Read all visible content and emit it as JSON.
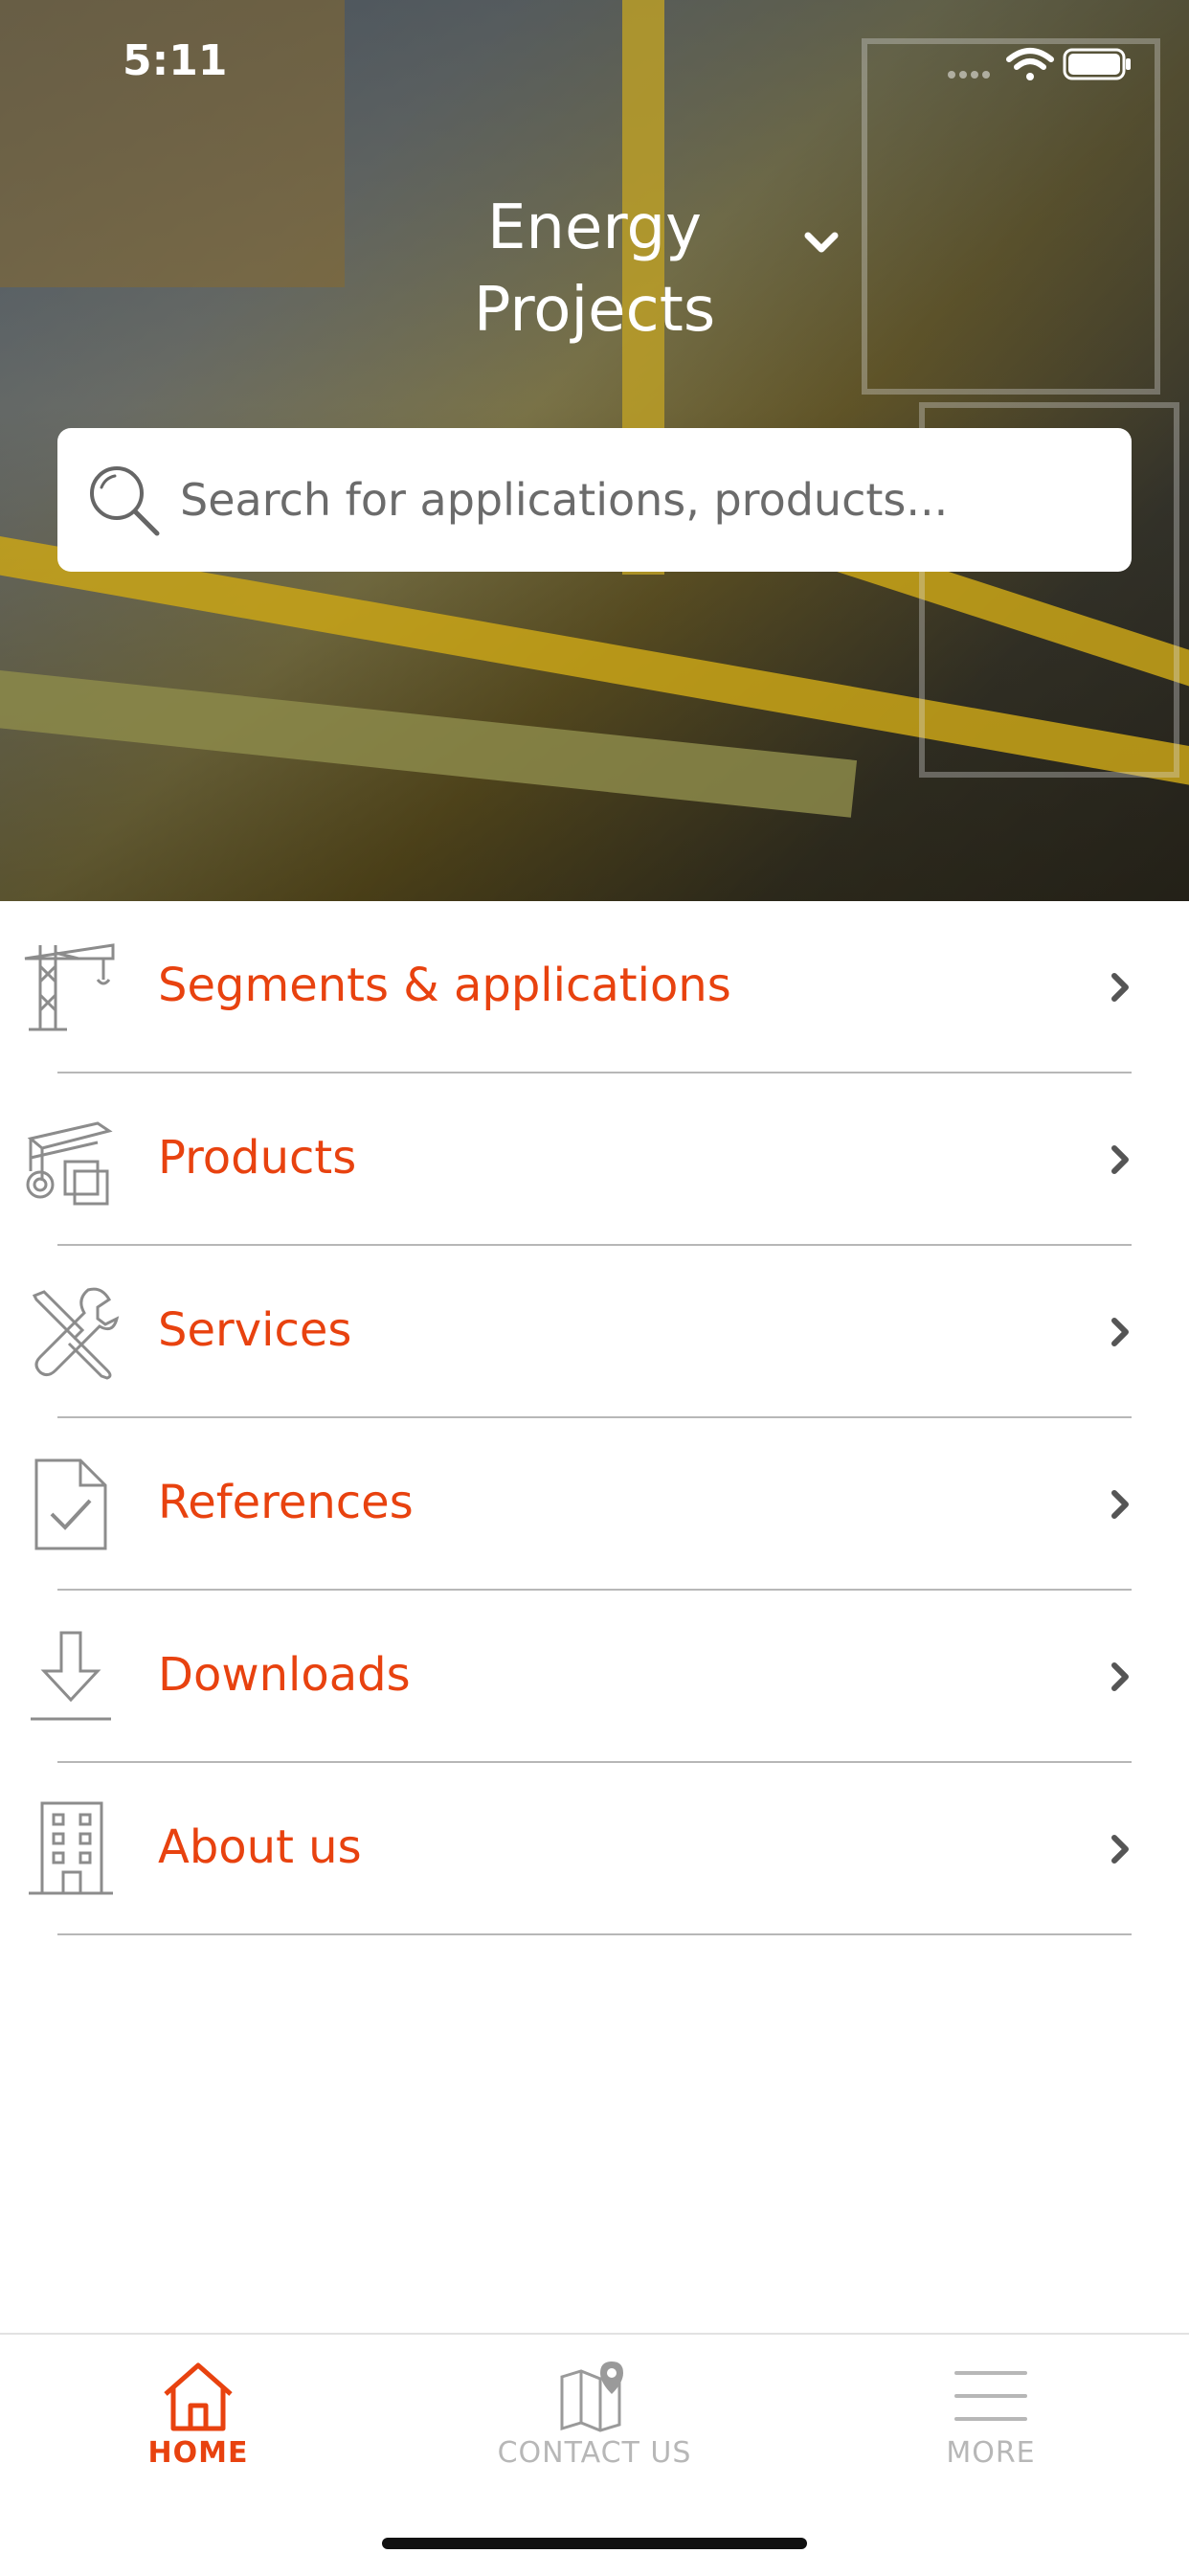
{
  "status_bar": {
    "time": "5:11"
  },
  "header": {
    "title": "Energy Projects"
  },
  "search": {
    "placeholder": "Search for applications, products..."
  },
  "menu": {
    "items": [
      {
        "label": "Segments & applications",
        "icon": "crane-icon"
      },
      {
        "label": "Products",
        "icon": "steel-profiles-icon"
      },
      {
        "label": "Services",
        "icon": "tools-icon"
      },
      {
        "label": "References",
        "icon": "document-check-icon"
      },
      {
        "label": "Downloads",
        "icon": "download-icon"
      },
      {
        "label": "About us",
        "icon": "building-icon"
      }
    ]
  },
  "tabbar": {
    "tabs": [
      {
        "label": "HOME",
        "icon": "home-icon",
        "active": true
      },
      {
        "label": "CONTACT US",
        "icon": "map-pin-icon",
        "active": false
      },
      {
        "label": "MORE",
        "icon": "hamburger-menu-icon",
        "active": false
      }
    ]
  },
  "colors": {
    "accent": "#e8420f",
    "icon_gray": "#8c8c8c",
    "divider": "#b7b7b7"
  }
}
